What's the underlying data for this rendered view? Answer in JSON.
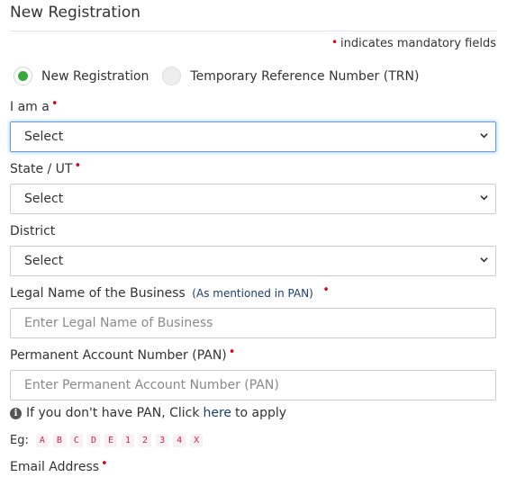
{
  "header": {
    "title": "New Registration"
  },
  "mandatory_note": {
    "text": "indicates mandatory fields",
    "marker": "•"
  },
  "registration_type": {
    "options": [
      {
        "label": "New Registration",
        "selected": true
      },
      {
        "label": "Temporary Reference Number (TRN)",
        "selected": false
      }
    ]
  },
  "form": {
    "iam": {
      "label": "I am a",
      "value": "Select"
    },
    "state": {
      "label": "State / UT",
      "value": "Select"
    },
    "district": {
      "label": "District",
      "value": "Select"
    },
    "legal_name": {
      "label": "Legal Name of the Business",
      "hint": "(As mentioned in PAN)",
      "placeholder": "Enter Legal Name of Business"
    },
    "pan": {
      "label": "Permanent Account Number (PAN)",
      "placeholder": "Enter Permanent Account Number (PAN)"
    },
    "email": {
      "label": "Email Address"
    }
  },
  "pan_help": {
    "prefix": "If you don't have PAN, Click",
    "link": "here",
    "suffix": "to apply"
  },
  "example": {
    "label": "Eg:",
    "chars": [
      "A",
      "B",
      "C",
      "D",
      "E",
      "1",
      "2",
      "3",
      "4",
      "X"
    ]
  },
  "colors": {
    "required": "#e0001b",
    "radio_checked": "#3aa83a",
    "link": "#1a3e72",
    "focus": "#6aa0d6"
  },
  "icons": {
    "select_arrow": "chevron-down-icon",
    "info": "info-icon"
  }
}
